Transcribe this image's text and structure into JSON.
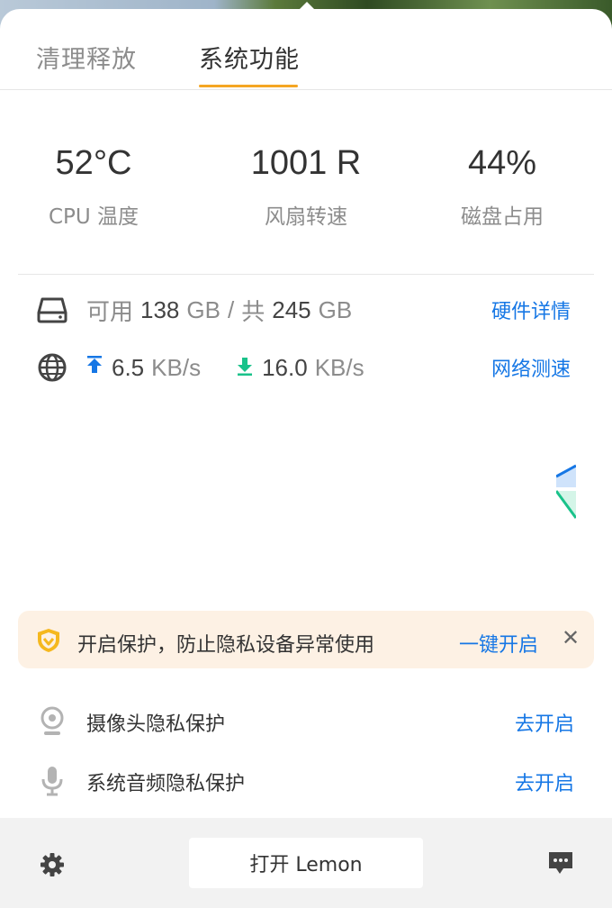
{
  "tabs": [
    {
      "label": "清理释放",
      "active": false
    },
    {
      "label": "系统功能",
      "active": true
    }
  ],
  "stats": [
    {
      "value": "52°C",
      "label": "CPU 温度"
    },
    {
      "value": "1001 R",
      "label": "风扇转速"
    },
    {
      "value": "44%",
      "label": "磁盘占用"
    }
  ],
  "disk": {
    "available_prefix": "可用",
    "available_value": "138",
    "available_unit": "GB",
    "separator": "/",
    "total_prefix": "共",
    "total_value": "245",
    "total_unit": "GB",
    "link": "硬件详情",
    "icon": "disk-icon"
  },
  "network": {
    "upload_value": "6.5",
    "upload_unit": "KB/s",
    "download_value": "16.0",
    "download_unit": "KB/s",
    "link": "网络测速",
    "icon": "globe-icon",
    "upload_color": "#1677e5",
    "download_color": "#19c28a"
  },
  "banner": {
    "message": "开启保护，防止隐私设备异常使用",
    "action": "一键开启",
    "close": "✕",
    "icon": "shield-icon",
    "background": "#fdf1e4"
  },
  "privacy": [
    {
      "label": "摄像头隐私保护",
      "action": "去开启",
      "icon": "camera-icon"
    },
    {
      "label": "系统音频隐私保护",
      "action": "去开启",
      "icon": "microphone-icon"
    }
  ],
  "footer": {
    "open_button": "打开 Lemon",
    "settings_icon": "gear-icon",
    "feedback_icon": "chat-icon"
  },
  "colors": {
    "accent": "#f5a623",
    "link": "#1677e5"
  }
}
